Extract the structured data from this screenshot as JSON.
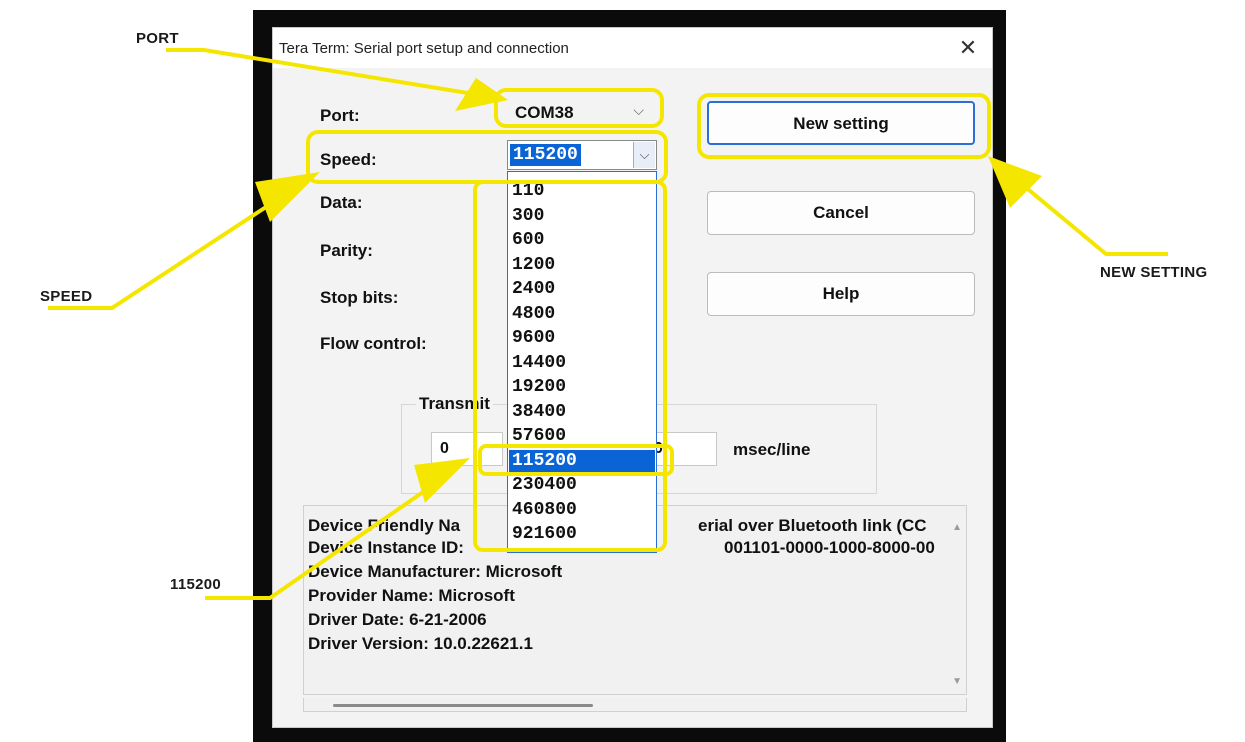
{
  "callouts": {
    "port": "PORT",
    "speed": "SPEED",
    "new_setting": "NEW SETTING",
    "baud": "115200"
  },
  "dialog": {
    "title": "Tera Term: Serial port setup and connection",
    "close_glyph": "✕"
  },
  "labels": {
    "port": "Port:",
    "speed": "Speed:",
    "data": "Data:",
    "parity": "Parity:",
    "stop_bits": "Stop bits:",
    "flow_control": "Flow control:"
  },
  "port_select": {
    "value": "COM38",
    "chevron": "⌵"
  },
  "speed_select": {
    "value": "115200",
    "chevron": "⌵"
  },
  "speed_options": [
    "110",
    "300",
    "600",
    "1200",
    "2400",
    "4800",
    "9600",
    "14400",
    "19200",
    "38400",
    "57600",
    "115200",
    "230400",
    "460800",
    "921600"
  ],
  "speed_selected": "115200",
  "buttons": {
    "new_setting": "New setting",
    "cancel": "Cancel",
    "help": "Help"
  },
  "transmit": {
    "legend": "Transmit",
    "char_delay": "0",
    "line_delay": "0",
    "line_unit": "msec/line"
  },
  "device_info": {
    "line1_left": "Device Friendly Na",
    "line1_right": "erial over Bluetooth link (CC",
    "line2_left": "Device Instance ID:",
    "line2_right": "001101-0000-1000-8000-00",
    "manufacturer": "Device Manufacturer: Microsoft",
    "provider": "Provider Name: Microsoft",
    "driver_date": "Driver Date: 6-21-2006",
    "driver_version": "Driver Version: 10.0.22621.1",
    "scroll_up": "▲",
    "scroll_down": "▼"
  },
  "colors": {
    "highlight": "#f5e600",
    "selection": "#0a64d6",
    "frame": "#0b0b0b"
  }
}
